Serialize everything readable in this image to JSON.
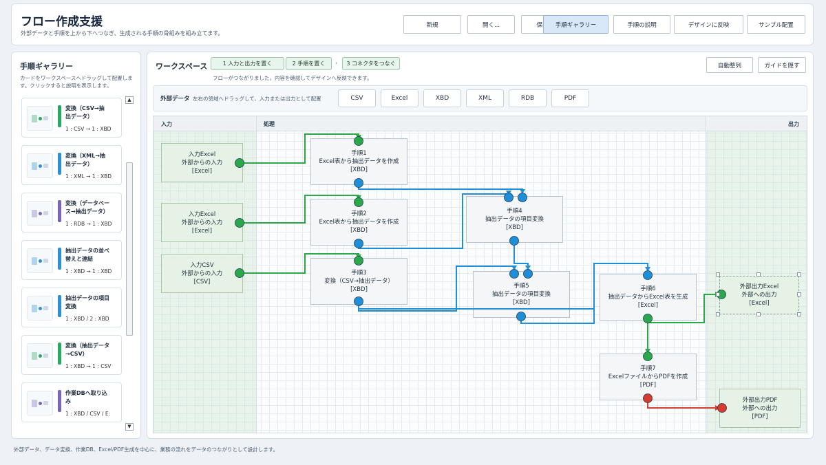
{
  "header": {
    "title": "フロー作成支援",
    "subtitle": "外部データと手順を上から下へつなぎ、生成される手順の骨組みを組み立てます。",
    "buttons": [
      {
        "label": "新規"
      },
      {
        "label": "開く..."
      },
      {
        "label": "保存"
      },
      {
        "label": "手順ギャラリー",
        "active": true
      },
      {
        "label": "手順の説明"
      },
      {
        "label": "デザインに反映"
      },
      {
        "label": "サンプル配置"
      }
    ]
  },
  "sidebar": {
    "title": "手順ギャラリー",
    "description": "カードをワークスペースへドラッグして配置します。クリックすると説明を表示します。",
    "cards": [
      {
        "title": "変換（CSV→抽\n出データ）",
        "io": "1 : CSV → 1 : XBD",
        "bar_color": "#2aa665",
        "icon": "csv-convert-icon"
      },
      {
        "title": "変換（XML→抽\n出データ）",
        "io": "1 : XML → 1 : XBD",
        "bar_color": "#2f8fd0",
        "icon": "xml-convert-icon"
      },
      {
        "title": "変換（データベー\nス→抽出データ）",
        "io": "1 : RDB → 1 : XBD",
        "bar_color": "#7a66b8",
        "icon": "database-convert-icon"
      },
      {
        "title": "抽出データの並べ\n替えと連結",
        "io": "1 : XBD → 1 : XBD",
        "bar_color": "#2f8fd0",
        "icon": "sort-join-icon"
      },
      {
        "title": "抽出データの項目\n変換",
        "io": "1 : XBD / 2 : XBD",
        "bar_color": "#2f8fd0",
        "icon": "field-convert-icon"
      },
      {
        "title": "変換（抽出データ\n→CSV）",
        "io": "1 : XBD → 1 : CSV",
        "bar_color": "#2aa665",
        "icon": "xbd-to-csv-icon"
      },
      {
        "title": "作業DBへ取り込\nみ",
        "io": "1 : XBD / CSV / E:",
        "bar_color": "#7a66b8",
        "icon": "import-db-icon"
      }
    ],
    "scroll_up": "▲",
    "scroll_down": "▼"
  },
  "workspace": {
    "title": "ワークスペース",
    "steps": [
      {
        "label": "1  入力と出力を置く"
      },
      {
        "label": "2  手順を置く"
      },
      {
        "label": "3  コネクタをつなぐ"
      }
    ],
    "step_separator": "›",
    "status": "フローがつながりました。内容を確認してデザインへ反映できます。",
    "auto_arrange": "自動整列",
    "hide_guide": "ガイドを隠す",
    "external": {
      "label": "外部データ",
      "description": "左右の領域へドラッグして、入力または出力として配置",
      "formats": [
        "CSV",
        "Excel",
        "XBD",
        "XML",
        "RDB",
        "PDF"
      ]
    },
    "lanes": {
      "input": "入力",
      "process": "処理",
      "output": "出力"
    },
    "nodes": {
      "in1": "入力Excel\n外部からの入力\n[Excel]",
      "in2": "入力Excel\n外部からの入力\n[Excel]",
      "in3": "入力CSV\n外部からの入力\n[CSV]",
      "p1": "手順1\nExcel表から抽出データを作成\n[XBD]",
      "p2": "手順2\nExcel表から抽出データを作成\n[XBD]",
      "p3": "手順3\n変換（CSV→抽出データ）\n[XBD]",
      "p4": "手順4\n抽出データの項目変換\n[XBD]",
      "p5": "手順5\n抽出データの項目変換\n[XBD]",
      "p6": "手順6\n抽出データからExcel表を生成\n[Excel]",
      "p7": "手順7\nExcelファイルからPDFを作成\n[PDF]",
      "out1": "外部出力Excel\n外部への出力\n[Excel]",
      "out2": "外部出力PDF\n外部への出力\n[PDF]"
    }
  },
  "colors": {
    "green": "#2aa84a",
    "blue": "#1f8ed8",
    "red": "#d83a2e",
    "accent": "#d8e8f7"
  },
  "footer": "外部データ、データ変換、作業DB、Excel/PDF生成を中心に、業務の流れをデータのつながりとして設計します。"
}
